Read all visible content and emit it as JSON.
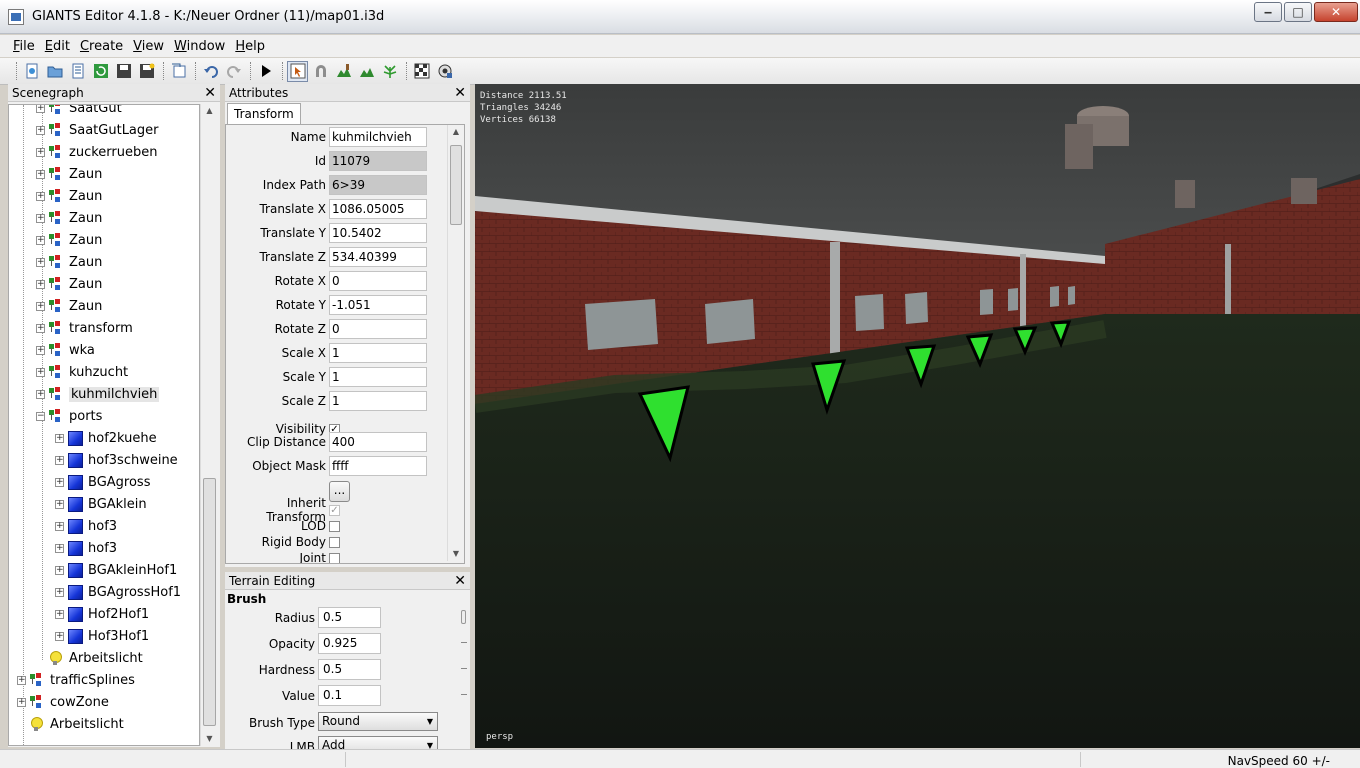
{
  "window": {
    "title": "GIANTS Editor 4.1.8 - K:/Neuer Ordner (11)/map01.i3d",
    "min_glyph": "‒",
    "max_glyph": "□",
    "close_glyph": "✕"
  },
  "menu": [
    {
      "first": "F",
      "rest": "ile"
    },
    {
      "first": "E",
      "rest": "dit"
    },
    {
      "first": "C",
      "rest": "reate"
    },
    {
      "first": "V",
      "rest": "iew"
    },
    {
      "first": "W",
      "rest": "indow"
    },
    {
      "first": "H",
      "rest": "elp"
    }
  ],
  "toolbar": {
    "icons": [
      "new-icon",
      "open-icon",
      "list-icon",
      "refresh-icon",
      "save-icon",
      "save-as-icon",
      "import-icon",
      "undo-icon",
      "redo-icon",
      "play-icon",
      "select-icon",
      "magnet-icon",
      "terrain-paint-icon",
      "terrain-sculpt-icon",
      "foliage-icon",
      "checker-icon",
      "settings-icon"
    ]
  },
  "scenegraph": {
    "title": "Scenegraph",
    "close": "✕",
    "items": [
      {
        "label": "SaatGut",
        "type": "group",
        "level": 1
      },
      {
        "label": "SaatGutLager",
        "type": "group",
        "level": 1
      },
      {
        "label": "zuckerrueben",
        "type": "group",
        "level": 1
      },
      {
        "label": "Zaun",
        "type": "group",
        "level": 1
      },
      {
        "label": "Zaun",
        "type": "group",
        "level": 1
      },
      {
        "label": "Zaun",
        "type": "group",
        "level": 1
      },
      {
        "label": "Zaun",
        "type": "group",
        "level": 1
      },
      {
        "label": "Zaun",
        "type": "group",
        "level": 1
      },
      {
        "label": "Zaun",
        "type": "group",
        "level": 1
      },
      {
        "label": "Zaun",
        "type": "group",
        "level": 1
      },
      {
        "label": "transform",
        "type": "group",
        "level": 1
      },
      {
        "label": "wka",
        "type": "group",
        "level": 1
      },
      {
        "label": "kuhzucht",
        "type": "group",
        "level": 1
      },
      {
        "label": "kuhmilchvieh",
        "type": "group",
        "level": 1,
        "selected": true
      },
      {
        "label": "ports",
        "type": "group",
        "level": 1,
        "expanded": true
      },
      {
        "label": "hof2kuehe",
        "type": "shape",
        "level": 2
      },
      {
        "label": "hof3schweine",
        "type": "shape",
        "level": 2
      },
      {
        "label": "BGAgross",
        "type": "shape",
        "level": 2
      },
      {
        "label": "BGAklein",
        "type": "shape",
        "level": 2
      },
      {
        "label": "hof3",
        "type": "shape",
        "level": 2
      },
      {
        "label": "hof3",
        "type": "shape",
        "level": 2
      },
      {
        "label": "BGAkleinHof1",
        "type": "shape",
        "level": 2
      },
      {
        "label": "BGAgrossHof1",
        "type": "shape",
        "level": 2
      },
      {
        "label": "Hof2Hof1",
        "type": "shape",
        "level": 2
      },
      {
        "label": "Hof3Hof1",
        "type": "shape",
        "level": 2
      },
      {
        "label": "Arbeitslicht",
        "type": "light",
        "level": 1
      },
      {
        "label": "trafficSplines",
        "type": "group",
        "level": 0
      },
      {
        "label": "cowZone",
        "type": "group",
        "level": 0
      },
      {
        "label": "Arbeitslicht",
        "type": "light",
        "level": 0
      }
    ]
  },
  "attributes": {
    "title": "Attributes",
    "close": "✕",
    "tab": "Transform",
    "fields": [
      {
        "label": "Name",
        "value": "kuhmilchvieh",
        "readonly": false
      },
      {
        "label": "Id",
        "value": "11079",
        "readonly": true
      },
      {
        "label": "Index Path",
        "value": "6>39",
        "readonly": true
      },
      {
        "label": "Translate X",
        "value": "1086.05005",
        "readonly": false
      },
      {
        "label": "Translate Y",
        "value": "10.5402",
        "readonly": false
      },
      {
        "label": "Translate Z",
        "value": "534.40399",
        "readonly": false
      },
      {
        "label": "Rotate X",
        "value": "0",
        "readonly": false
      },
      {
        "label": "Rotate Y",
        "value": "-1.051",
        "readonly": false
      },
      {
        "label": "Rotate Z",
        "value": "0",
        "readonly": false
      },
      {
        "label": "Scale X",
        "value": "1",
        "readonly": false
      },
      {
        "label": "Scale Y",
        "value": "1",
        "readonly": false
      },
      {
        "label": "Scale Z",
        "value": "1",
        "readonly": false
      }
    ],
    "visibility_label": "Visibility",
    "visibility_checked": true,
    "clip_distance_label": "Clip Distance",
    "clip_distance": "400",
    "object_mask_label": "Object Mask",
    "object_mask": "ffff",
    "dots_button": "...",
    "checkboxes": [
      {
        "label": "Inherit Transform",
        "checked": true,
        "disabled": true
      },
      {
        "label": "LOD",
        "checked": false,
        "disabled": false
      },
      {
        "label": "Rigid Body",
        "checked": false,
        "disabled": false
      },
      {
        "label": "Joint",
        "checked": false,
        "disabled": false
      }
    ]
  },
  "terrain": {
    "title": "Terrain Editing",
    "close": "✕",
    "brush_heading": "Brush",
    "fields": [
      {
        "label": "Radius",
        "value": "0.5"
      },
      {
        "label": "Opacity",
        "value": "0.925"
      },
      {
        "label": "Hardness",
        "value": "0.5"
      },
      {
        "label": "Value",
        "value": "0.1"
      }
    ],
    "brush_type_label": "Brush Type",
    "brush_type": "Round",
    "lmb_label": "LMB",
    "lmb": "Add"
  },
  "viewport": {
    "stats": [
      "Distance 2113.51",
      "Triangles 34246",
      "Vertices 66138"
    ],
    "camera": "persp"
  },
  "status": {
    "nav_speed": "NavSpeed 60 +/-"
  }
}
